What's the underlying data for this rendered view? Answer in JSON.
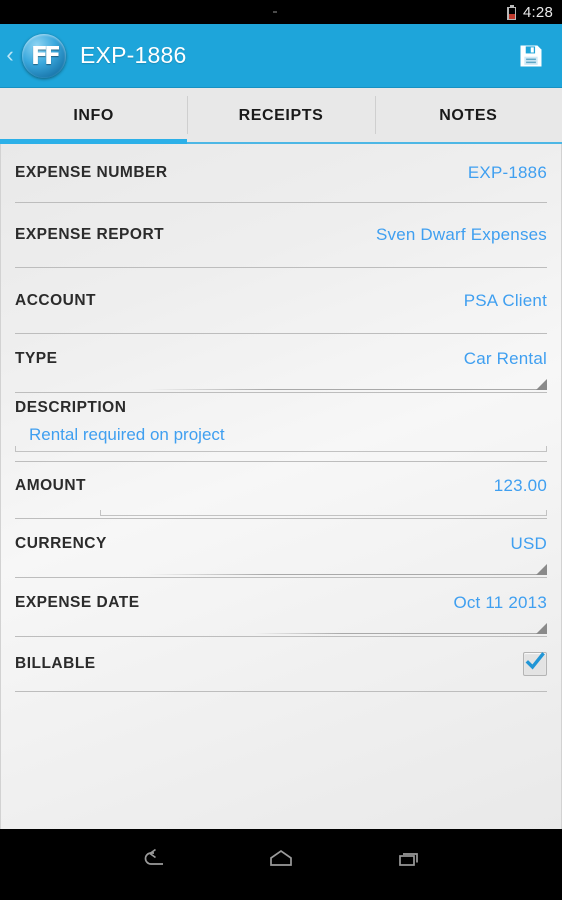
{
  "statusbar": {
    "time": "4:28",
    "battery_icon": "battery-low-icon"
  },
  "actionbar": {
    "back_icon": "back-chevron-icon",
    "logo_icon": "app-logo-icon",
    "logo_text": "FF",
    "title": "EXP-1886",
    "save_icon": "save-floppy-icon"
  },
  "tabs": [
    {
      "label": "INFO",
      "active": true
    },
    {
      "label": "RECEIPTS",
      "active": false
    },
    {
      "label": "NOTES",
      "active": false
    }
  ],
  "form": {
    "expense_number": {
      "label": "EXPENSE NUMBER",
      "value": "EXP-1886"
    },
    "expense_report": {
      "label": "EXPENSE REPORT",
      "value": "Sven Dwarf Expenses"
    },
    "account": {
      "label": "ACCOUNT",
      "value": "PSA Client"
    },
    "type": {
      "label": "TYPE",
      "value": "Car Rental"
    },
    "description": {
      "label": "DESCRIPTION",
      "value": "Rental required on project"
    },
    "amount": {
      "label": "AMOUNT",
      "value": "123.00"
    },
    "currency": {
      "label": "CURRENCY",
      "value": "USD"
    },
    "expense_date": {
      "label": "EXPENSE DATE",
      "value": "Oct 11 2013"
    },
    "billable": {
      "label": "BILLABLE",
      "checked": true
    }
  },
  "navbar": {
    "back_icon": "nav-back-icon",
    "home_icon": "nav-home-icon",
    "recents_icon": "nav-recents-icon"
  },
  "colors": {
    "accent_blue": "#1ea5da",
    "value_blue": "#3f9ff0",
    "tab_underline": "#2cb0e8",
    "content_bg": "#f1f1f1"
  }
}
